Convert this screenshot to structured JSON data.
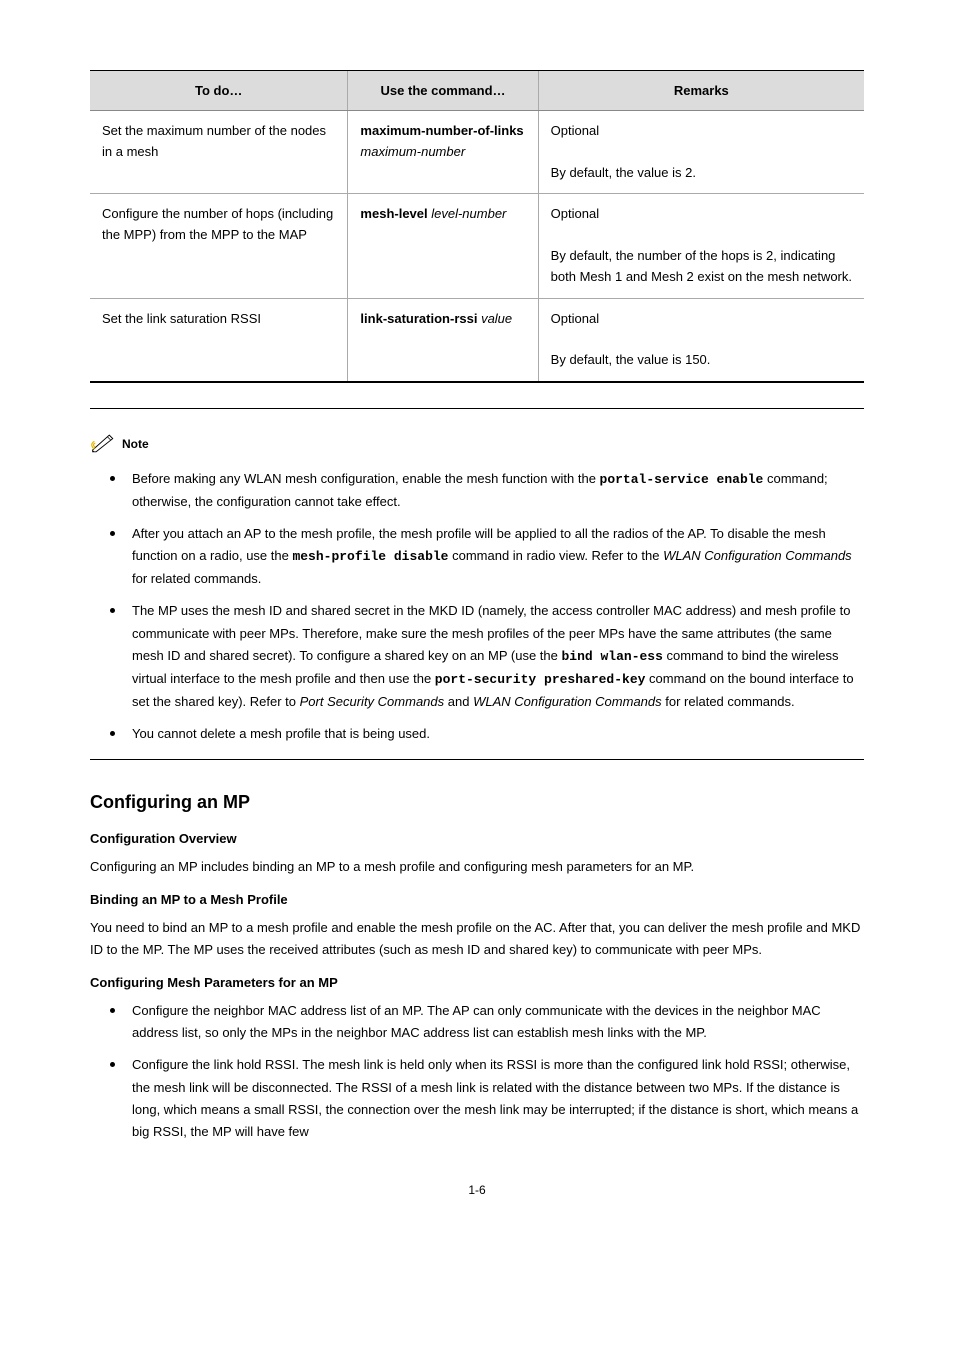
{
  "table": {
    "headers": [
      "To do…",
      "Use the command…",
      "Remarks"
    ],
    "rows": [
      {
        "c1": "Set the maximum number of the nodes in a mesh",
        "c2_a": "maximum-number-of-links",
        "c2_b": " maximum-number",
        "c3": "Optional\n\nBy default, the value is 2."
      },
      {
        "c1": "Configure the number of hops (including the MPP) from the MPP to the MAP",
        "c2_a": "mesh-level",
        "c2_b": " level-number",
        "c3": "Optional\n\nBy default, the number of the hops is 2, indicating both Mesh 1 and Mesh 2 exist on the mesh network."
      },
      {
        "c1": "Set the link saturation RSSI",
        "c2_a": "link-saturation-rssi",
        "c2_b": " value",
        "c3": "Optional\n\nBy default, the value is 150."
      }
    ]
  },
  "notes": [
    "Before making any WLAN mesh configuration, enable the mesh function with the <mono>portal-service enable</mono> command; otherwise, the configuration cannot take effect.",
    "After you attach an AP to the mesh profile, the mesh profile will be applied to all the radios of the AP. To disable the mesh function on a radio, use the <mono>mesh-profile disable</mono> command in radio view. Refer to the <emph>WLAN Configuration Commands</emph> for related commands.",
    "The MP uses the mesh ID and shared secret in the MKD ID (namely, the access controller MAC address) and mesh profile to communicate with peer MPs. Therefore, make sure the mesh profiles of the peer MPs have the same attributes (the same mesh ID and shared secret). To configure a shared key on an MP (use the <mono>bind wlan-ess</mono> command to bind the wireless virtual interface to the mesh profile and then use the <mono>port-security preshared-key</mono> command on the bound interface to set the shared key). Refer to <emph>Port Security Commands</emph> and <emph>WLAN Configuration Commands</emph> for related commands.",
    "You cannot delete a mesh profile that is being used."
  ],
  "section": {
    "heading": "Configuring an MP",
    "overview_title": "Configuration Overview",
    "overview_para": "Configuring an MP includes binding an MP to a mesh profile and configuring mesh parameters for an MP.",
    "bind_title": "Binding an MP to a Mesh Profile",
    "bind_para": "You need to bind an MP to a mesh profile and enable the mesh profile on the AC. After that, you can deliver the mesh profile and MKD ID to the MP. The MP uses the received attributes (such as mesh ID and shared key) to communicate with peer MPs.",
    "mesh_params_title": "Configuring Mesh Parameters for an MP",
    "mesh_params_bullets": [
      "Configure the neighbor MAC address list of an MP. The AP can only communicate with the devices in the neighbor MAC address list, so only the MPs in the neighbor MAC address list can establish mesh links with the MP.",
      "Configure the link hold RSSI. The mesh link is held only when its RSSI is more than the configured link hold RSSI; otherwise, the mesh link will be disconnected. The RSSI of a mesh link is related with the distance between two MPs. If the distance is long, which means a small RSSI, the connection over the mesh link may be interrupted; if the distance is short, which means a big RSSI, the MP will have few"
    ]
  },
  "page_number": "1-6"
}
